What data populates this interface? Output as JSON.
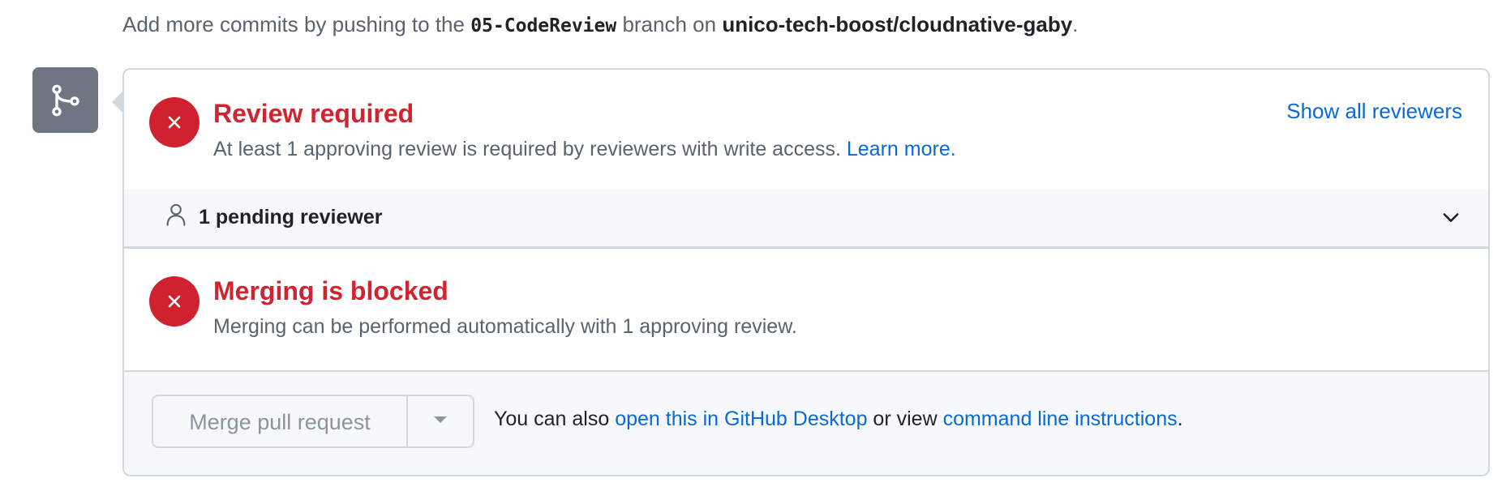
{
  "hint": {
    "prefix": "Add more commits by pushing to the ",
    "branch": "05-CodeReview",
    "middle": " branch on ",
    "repo": "unico-tech-boost/cloudnative-gaby",
    "suffix": "."
  },
  "review": {
    "title": "Review required",
    "description": "At least 1 approving review is required by reviewers with write access. ",
    "learn_more": "Learn more.",
    "show_all": "Show all reviewers"
  },
  "pending": {
    "label": "1 pending reviewer"
  },
  "blocked": {
    "title": "Merging is blocked",
    "description": "Merging can be performed automatically with 1 approving review."
  },
  "merge": {
    "button_label": "Merge pull request",
    "text_prefix": "You can also ",
    "desktop_link": "open this in GitHub Desktop",
    "text_middle": " or view ",
    "cli_link": "command line instructions",
    "text_suffix": "."
  },
  "colors": {
    "error": "#cf222e",
    "link": "#0969da",
    "icon_bg": "#6e7781"
  },
  "icons": {
    "merge": "git-merge-icon",
    "status": "x-circle-icon",
    "person": "person-icon",
    "chevron": "chevron-down-icon",
    "dropdown": "triangle-down-icon"
  }
}
